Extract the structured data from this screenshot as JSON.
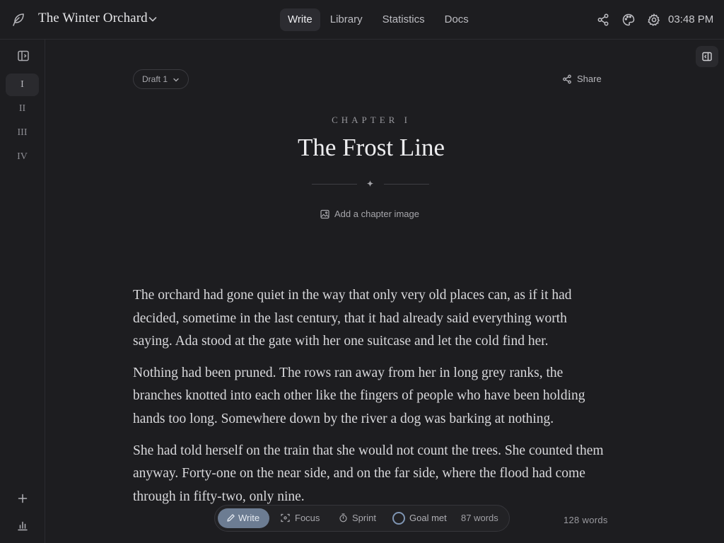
{
  "app": {
    "project_title": "The Winter Orchard",
    "time": "03:48 PM",
    "nav": [
      "Write",
      "Library",
      "Statistics",
      "Docs"
    ],
    "active_nav": "Write",
    "icons": [
      "feather-icon",
      "chevron-down-icon",
      "share-icon",
      "palette-icon",
      "gear-icon"
    ]
  },
  "rail": {
    "chapters": [
      "I",
      "II",
      "III",
      "IV"
    ],
    "active_chapter": "I",
    "icons": [
      "sidebar-toggle-icon",
      "plus-icon",
      "bar-chart-icon"
    ]
  },
  "editor": {
    "draft_label": "Draft 1",
    "share_label": "Share",
    "chapter_label": "CHAPTER I",
    "chapter_title": "The Frost Line",
    "add_image_label": "Add a chapter image",
    "paragraphs": [
      "The orchard had gone quiet in the way that only very old places can, as if it had decided, sometime in the last century, that it had already said everything worth saying. Ada stood at the gate with her one suitcase and let the cold find her.",
      "Nothing had been pruned. The rows ran away from her in long grey ranks, the branches knotted into each other like the fingers of people who have been holding hands too long. Somewhere down by the river a dog was barking at nothing.",
      "She had told herself on the train that she would not count the trees. She counted them anyway. Forty-one on the near side, and on the far side, where the flood had come through in fifty-two, only nine."
    ]
  },
  "toolbar": {
    "write_label": "Write",
    "focus_label": "Focus",
    "sprint_label": "Sprint",
    "goal_label": "Goal met",
    "goal_words": "87 words",
    "goal_ring_color": "#7f95b3",
    "accent_color": "#6c7c92"
  },
  "status": {
    "word_count": "128 words"
  }
}
